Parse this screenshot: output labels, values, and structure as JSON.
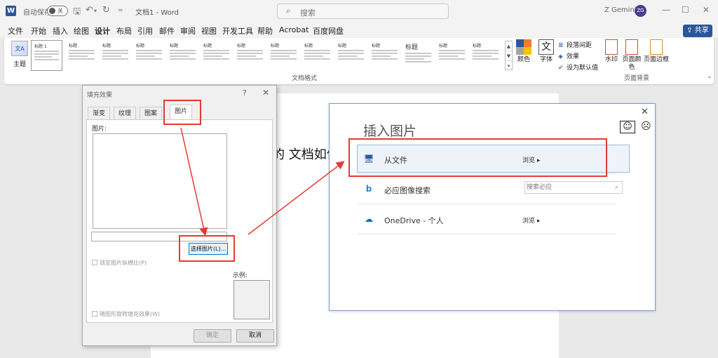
{
  "titlebar": {
    "autosave_label": "自动保存",
    "autosave_state": "关",
    "doc_title": "文档1 - Word",
    "search_placeholder": "搜索",
    "user_name": "Z Gemini",
    "user_initials": "ZG"
  },
  "menu": {
    "items": [
      "文件",
      "开始",
      "插入",
      "绘图",
      "设计",
      "布局",
      "引用",
      "邮件",
      "审阅",
      "视图",
      "开发工具",
      "帮助",
      "Acrobat",
      "百度网盘"
    ],
    "active": "设计",
    "share_label": "共享"
  },
  "ribbon": {
    "theme_label": "主题",
    "styles_group_label": "文档格式",
    "style_heading": "标题",
    "first_style_heading": "标题 1",
    "colors_label": "颜色",
    "fonts_label": "字体",
    "paragraph_spacing_label": "段落间距",
    "effects_label": "效果",
    "set_default_label": "设为默认值",
    "watermark_label": "水印",
    "page_color_label": "页面颜色",
    "page_borders_label": "页面边框",
    "page_bg_group_label": "页面背景",
    "theme_colors": [
      "#2b579a",
      "#ed7d31",
      "#a5a5a5",
      "#ffc000"
    ]
  },
  "document": {
    "visible_text": "的 文档如何"
  },
  "fill_dialog": {
    "title": "填充效果",
    "help": "?",
    "tabs": [
      "渐变",
      "纹理",
      "图案",
      "图片"
    ],
    "active_tab": "图片",
    "picture_label": "图片:",
    "select_button": "选择图片(L)...",
    "lock_aspect": "锁定图片纵横比(P)",
    "rotate_with_shape": "随图形旋转填充效果(W)",
    "sample_label": "示例:",
    "ok": "确定",
    "cancel": "取消"
  },
  "insert_picture": {
    "title": "插入图片",
    "rows": [
      {
        "name": "从文件",
        "action": "浏览",
        "icon": "computer-icon"
      },
      {
        "name": "必应图像搜索",
        "search_placeholder": "搜索必应",
        "icon": "bing-icon"
      },
      {
        "name": "OneDrive - 个人",
        "action": "浏览",
        "icon": "onedrive-icon"
      }
    ]
  },
  "colors": {
    "accent": "#2b579a",
    "highlight": "#e53935"
  }
}
